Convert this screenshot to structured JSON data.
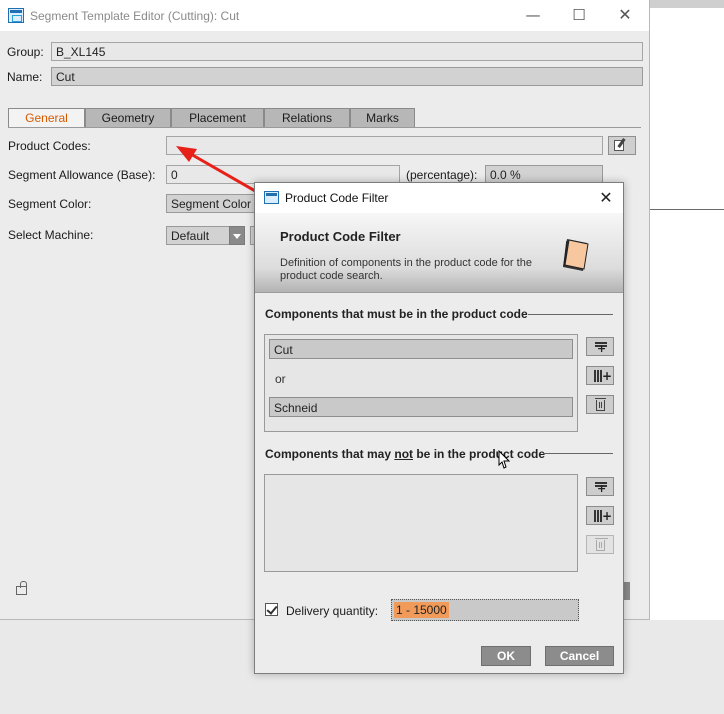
{
  "main_window": {
    "title": "Segment Template Editor (Cutting): Cut",
    "controls": {
      "minimize": "—",
      "maximize": "☐",
      "close": "✕"
    },
    "group": {
      "label": "Group:",
      "value": "B_XL145"
    },
    "name": {
      "label": "Name:",
      "value": "Cut"
    },
    "tabs": [
      {
        "label": "General",
        "active": true
      },
      {
        "label": "Geometry",
        "active": false
      },
      {
        "label": "Placement",
        "active": false
      },
      {
        "label": "Relations",
        "active": false
      },
      {
        "label": "Marks",
        "active": false
      }
    ],
    "product_codes": {
      "label": "Product Codes:",
      "value": ""
    },
    "segment_allowance": {
      "label": "Segment Allowance (Base):",
      "value": "0",
      "percentage_label": "(percentage):",
      "percentage_value": "0.0 %"
    },
    "segment_color": {
      "label": "Segment Color:",
      "value": "Segment Color"
    },
    "select_machine": {
      "label": "Select Machine:",
      "value": "Default"
    }
  },
  "dialog": {
    "title": "Product Code Filter",
    "close": "✕",
    "header_title": "Product Code Filter",
    "header_description": "Definition of components in the product code for the product code search.",
    "must_section": {
      "label": "Components that must be in the product code",
      "items": [
        "Cut",
        "Schneid"
      ],
      "separator": "or"
    },
    "may_not_section": {
      "label_before": "Components that may ",
      "label_emph": "not",
      "label_after": " be in the product code",
      "items": []
    },
    "delivery_quantity": {
      "label": "Delivery quantity:",
      "checked": true,
      "value": "1 - 15000"
    },
    "buttons": {
      "ok": "OK",
      "cancel": "Cancel"
    }
  },
  "colors": {
    "active_tab_text": "#d45a00",
    "selection_highlight": "#f09b5a",
    "annotation_arrow": "#e8201a",
    "button_bg": "#8c8c8c"
  }
}
